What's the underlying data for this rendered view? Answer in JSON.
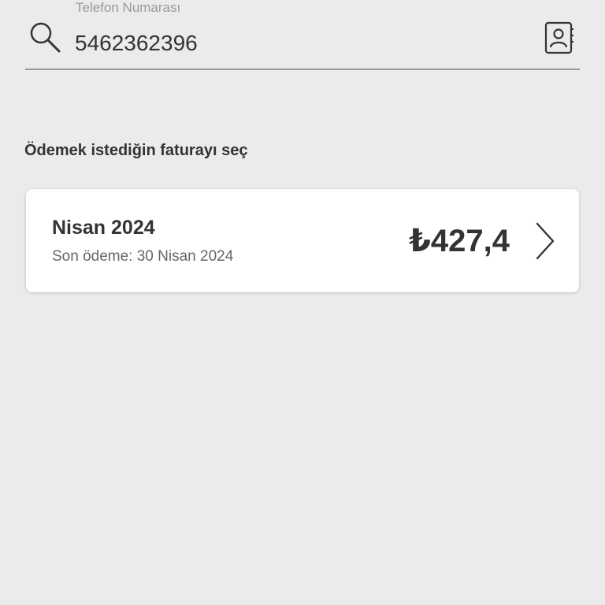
{
  "phone_field": {
    "label": "Telefon Numarası",
    "value": "5462362396",
    "search_icon": "search-icon",
    "contacts_icon": "contacts-book-icon"
  },
  "bills_section": {
    "title": "Ödemek istediğin faturayı seç"
  },
  "bills": [
    {
      "period": "Nisan 2024",
      "due_date": "Son ödeme: 30 Nisan 2024",
      "amount": "₺427,4",
      "chevron_icon": "chevron-right-icon"
    }
  ],
  "colors": {
    "background": "#ebebeb",
    "card": "#ffffff",
    "text_primary": "#333333",
    "text_secondary": "#666666",
    "underline": "#9a9a9a"
  }
}
